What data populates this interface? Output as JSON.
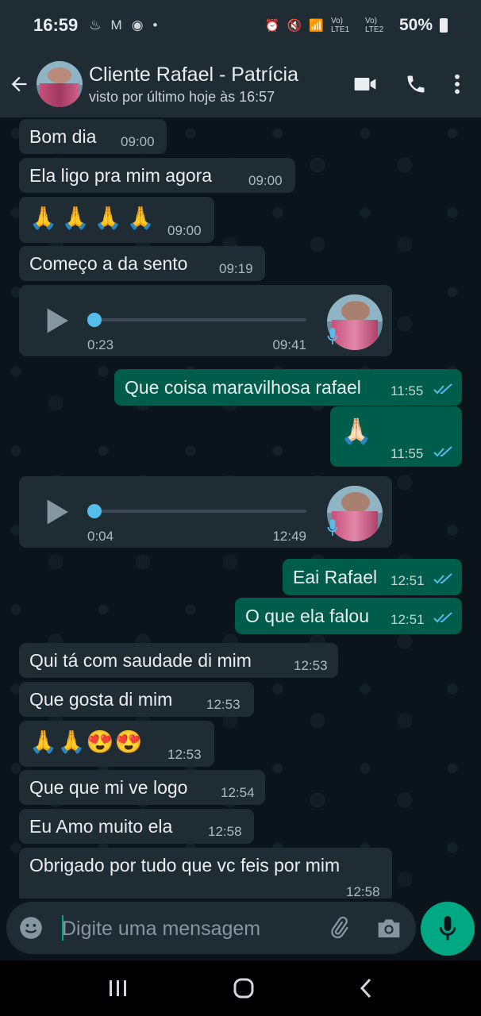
{
  "status_bar": {
    "time": "16:59",
    "lte1": "Vo) LTE1",
    "lte2": "Vo) LTE2",
    "battery": "50%"
  },
  "header": {
    "title": "Cliente Rafael - Patrícia",
    "subtitle": "visto por último hoje às 16:57"
  },
  "messages": [
    {
      "dir": "in",
      "text": "Bom dia",
      "time": "09:00"
    },
    {
      "dir": "in",
      "text": "Ela ligo pra mim agora",
      "time": "09:00"
    },
    {
      "dir": "in",
      "text": "🙏🙏🙏🙏",
      "time": "09:00"
    },
    {
      "dir": "in",
      "text": "Começo a da sento",
      "time": "09:19"
    },
    {
      "dir": "in",
      "type": "voice",
      "duration": "0:23",
      "time": "09:41"
    },
    {
      "dir": "out",
      "text": "Que coisa maravilhosa rafael",
      "time": "11:55",
      "status": "read"
    },
    {
      "dir": "out",
      "text": "🙏🏻",
      "time": "11:55",
      "status": "read"
    },
    {
      "dir": "in",
      "type": "voice",
      "duration": "0:04",
      "time": "12:49"
    },
    {
      "dir": "out",
      "text": "Eai Rafael",
      "time": "12:51",
      "status": "read"
    },
    {
      "dir": "out",
      "text": "O que ela falou",
      "time": "12:51",
      "status": "read"
    },
    {
      "dir": "in",
      "text": "Qui tá com saudade di mim",
      "time": "12:53"
    },
    {
      "dir": "in",
      "text": "Que gosta di mim",
      "time": "12:53"
    },
    {
      "dir": "in",
      "text": "🙏🙏😍😍",
      "time": "12:53"
    },
    {
      "dir": "in",
      "text": "Que que mi ve logo",
      "time": "12:54"
    },
    {
      "dir": "in",
      "text": "Eu Amo muito ela",
      "time": "12:58"
    },
    {
      "dir": "in",
      "text": "Obrigado por tudo que vc feis por mim",
      "time": "12:58"
    }
  ],
  "composer": {
    "placeholder": "Digite uma mensagem"
  },
  "colors": {
    "incoming": "#202c33",
    "outgoing": "#005c4b",
    "accent": "#00a884",
    "read_ticks": "#53bdeb"
  }
}
